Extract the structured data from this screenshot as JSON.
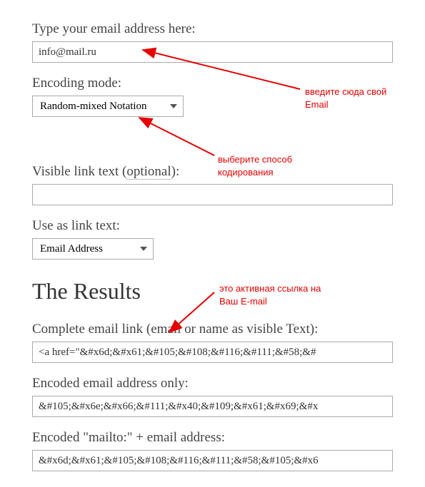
{
  "email": {
    "label": "Type your email address here:",
    "value": "info@mail.ru"
  },
  "encoding": {
    "label": "Encoding mode:",
    "selected": "Random-mixed Notation"
  },
  "visibleText": {
    "label_before": "Visible link text (",
    "label_optional": "optional",
    "label_after": "):",
    "value": ""
  },
  "linkText": {
    "label": "Use as link text:",
    "selected": "Email Address"
  },
  "results": {
    "heading": "The Results",
    "complete": {
      "label": "Complete email link (email or name as visible Text):",
      "value": "<a href=\"&#x6d;&#x61;&#105;&#108;&#116;&#111;&#58;&#"
    },
    "encodedEmail": {
      "label": "Encoded email address only:",
      "value": "&#105;&#x6e;&#x66;&#111;&#x40;&#109;&#x61;&#x69;&#x"
    },
    "encodedMailto": {
      "label": "Encoded \"mailto:\" + email address:",
      "value": "&#x6d;&#x61;&#105;&#108;&#116;&#111;&#58;&#105;&#x6"
    }
  },
  "annotations": {
    "enterEmail": "введите сюда свой\nEmail",
    "selectEncoding": "выберите способ\nкодирования",
    "activeLink": "это активная ссылка на\nВаш E-mail"
  }
}
